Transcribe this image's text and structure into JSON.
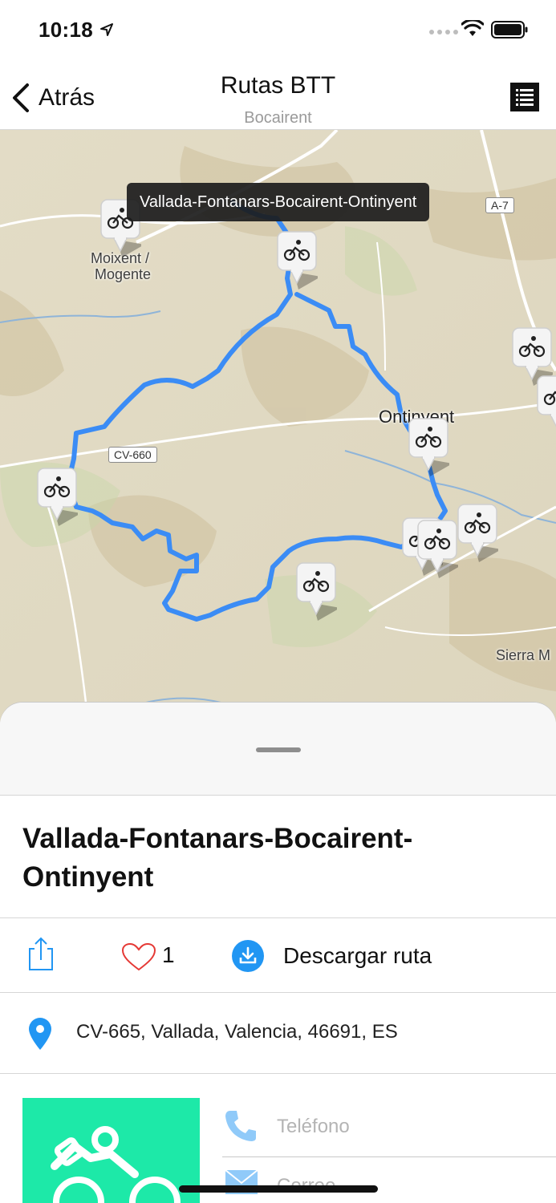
{
  "status_bar": {
    "time": "10:18"
  },
  "nav": {
    "back_label": "Atrás",
    "title": "Rutas BTT",
    "subtitle": "Bocairent"
  },
  "map": {
    "tooltip": "Vallada-Fontanars-Bocairent-Ontinyent",
    "places": [
      "Moixent /",
      "Mogente",
      "Ontinyent",
      "Sierra M"
    ],
    "roads": [
      "A-7",
      "CV-660"
    ],
    "pin_icon": "bicycle-icon",
    "route_color": "#3b8cf5"
  },
  "route": {
    "title": "Vallada-Fontanars-Bocairent-Ontinyent",
    "likes": "1",
    "download_label": "Descargar ruta",
    "address": "CV-665, Vallada, Valencia, 46691, ES",
    "phone_placeholder": "Teléfono",
    "mail_placeholder": "Correo"
  },
  "colors": {
    "accent": "#2196f3",
    "heart": "#e53935",
    "thumbnail": "#1de9a8"
  }
}
